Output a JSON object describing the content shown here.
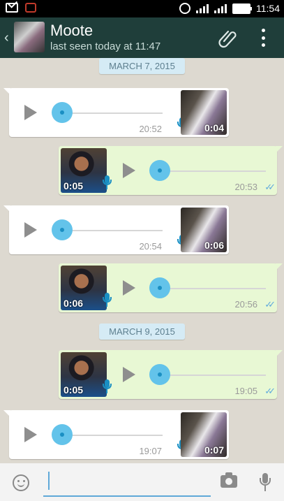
{
  "status_bar": {
    "time": "11:54"
  },
  "header": {
    "contact_name": "Moote",
    "last_seen": "last seen today at 11:47"
  },
  "dates": [
    "MARCH 7, 2015",
    "MARCH 9, 2015"
  ],
  "messages": [
    {
      "direction": "in",
      "duration": "0:04",
      "time": "20:52"
    },
    {
      "direction": "out",
      "duration": "0:05",
      "time": "20:53"
    },
    {
      "direction": "in",
      "duration": "0:06",
      "time": "20:54"
    },
    {
      "direction": "out",
      "duration": "0:06",
      "time": "20:56"
    },
    {
      "direction": "out",
      "duration": "0:05",
      "time": "19:05"
    },
    {
      "direction": "in",
      "duration": "0:07",
      "time": "19:07"
    }
  ],
  "input": {
    "placeholder": "",
    "value": ""
  },
  "icons": {
    "back": "back-arrow-icon",
    "attach": "paperclip-icon",
    "menu": "overflow-menu-icon",
    "emoji": "emoji-icon",
    "camera": "camera-icon",
    "mic": "microphone-icon",
    "ticks": "double-check-icon"
  },
  "colors": {
    "header": "#1f3e3a",
    "incoming": "#ffffff",
    "outgoing": "#e8f8d4",
    "accent": "#63c3ea",
    "date_chip": "#d5ebf5"
  }
}
